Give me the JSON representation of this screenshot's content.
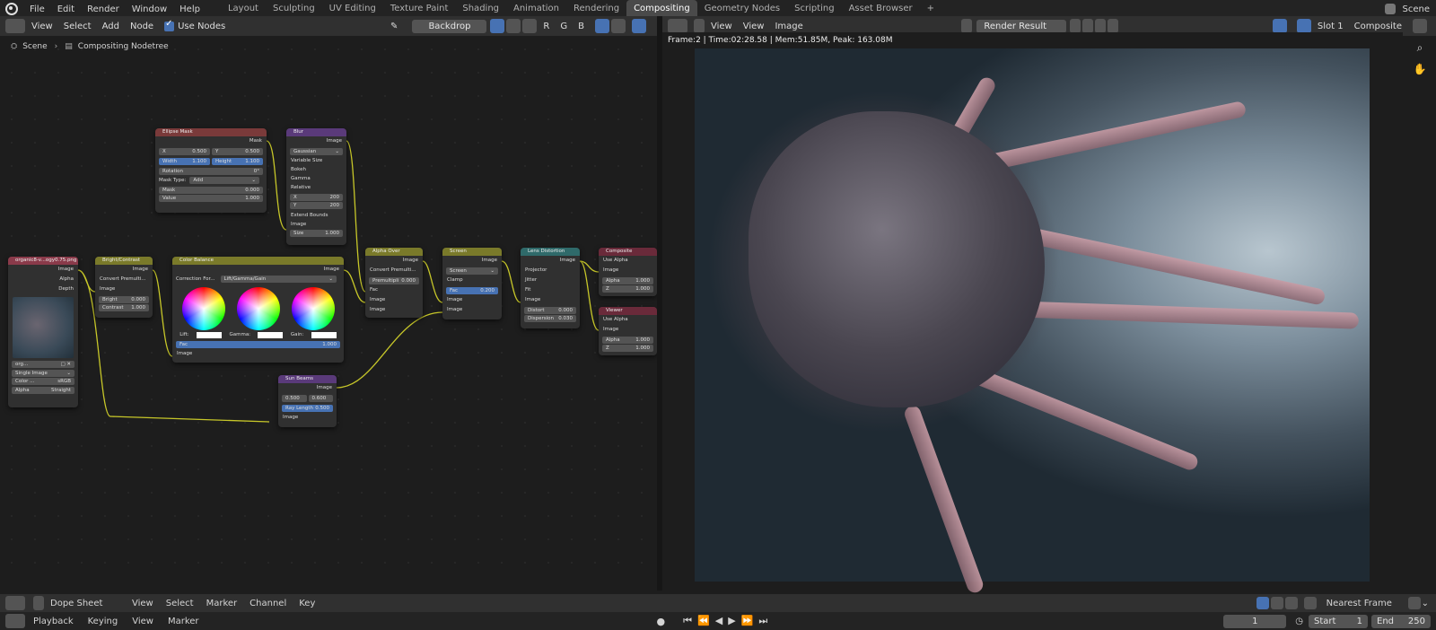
{
  "menu": [
    "File",
    "Edit",
    "Render",
    "Window",
    "Help"
  ],
  "workspaces": [
    "Layout",
    "Sculpting",
    "UV Editing",
    "Texture Paint",
    "Shading",
    "Animation",
    "Rendering",
    "Compositing",
    "Geometry Nodes",
    "Scripting",
    "Asset Browser"
  ],
  "active_workspace": "Compositing",
  "scene_name": "Scene",
  "node_header": {
    "menus": [
      "View",
      "Select",
      "Add",
      "Node"
    ],
    "use_nodes": "Use Nodes",
    "backdrop": "Backdrop",
    "channels": [
      "R",
      "G",
      "B"
    ]
  },
  "breadcrumb": [
    "Scene",
    "Compositing Nodetree"
  ],
  "image_header": {
    "menus": [
      "View",
      "View",
      "Image"
    ],
    "image_name": "Render Result",
    "slot": "Slot 1",
    "layer": "Composite"
  },
  "render_info": "Frame:2 | Time:02:28.58 | Mem:51.85M, Peak: 163.08M",
  "nodes": {
    "ellipse": {
      "title": "Ellipse Mask",
      "out": "Mask",
      "x": "X",
      "x_val": "0.500",
      "y": "Y",
      "y_val": "0.500",
      "width": "Width",
      "width_val": "1.100",
      "height": "Height",
      "height_val": "1.100",
      "rotation": "Rotation",
      "rotation_val": "0°",
      "mask_type": "Mask Type:",
      "mask_type_val": "Add",
      "mask": "Mask",
      "mask_val": "0.000",
      "value": "Value",
      "value_val": "1.000"
    },
    "blur": {
      "title": "Blur",
      "out": "Image",
      "filter": "Gaussian",
      "opts": [
        "Variable Size",
        "Bokeh",
        "Gamma",
        "Relative"
      ],
      "x": "X",
      "x_val": "200",
      "y": "Y",
      "y_val": "200",
      "extend": "Extend Bounds",
      "image": "Image",
      "size": "Size",
      "size_val": "1.000"
    },
    "input": {
      "title": "organic8-v...ogy0.75.png",
      "outs": [
        "Image",
        "Alpha",
        "Depth"
      ],
      "file": "org...",
      "source": "Single Image",
      "color": "Color ...",
      "color_val": "sRGB",
      "alpha": "Alpha",
      "alpha_val": "Straight"
    },
    "bright": {
      "title": "Bright/Contrast",
      "out": "Image",
      "convert": "Convert Premulti...",
      "image": "Image",
      "bright": "Bright",
      "bright_val": "0.000",
      "contrast": "Contrast",
      "contrast_val": "1.000"
    },
    "colorbal": {
      "title": "Color Balance",
      "out": "Image",
      "correction": "Correction For...",
      "correction_val": "Lift/Gamma/Gain",
      "lift": "Lift:",
      "gamma": "Gamma:",
      "gain": "Gain:",
      "fac": "Fac",
      "fac_val": "1.000",
      "image": "Image"
    },
    "alphaover": {
      "title": "Alpha Over",
      "out": "Image",
      "convert": "Convert Premulti...",
      "premul": "Premultipli",
      "premul_val": "0.000",
      "fac": "Fac",
      "image1": "Image",
      "image2": "Image"
    },
    "screen": {
      "title": "Screen",
      "out": "Image",
      "mode": "Screen",
      "clamp": "Clamp",
      "fac": "Fac",
      "fac_val": "0.200",
      "image1": "Image",
      "image2": "Image"
    },
    "lens": {
      "title": "Lens Distortion",
      "out": "Image",
      "projector": "Projector",
      "jitter": "Jitter",
      "fit": "Fit",
      "image": "Image",
      "distort": "Distort",
      "distort_val": "0.000",
      "dispersion": "Dispersion",
      "dispersion_val": "0.030"
    },
    "composite": {
      "title": "Composite",
      "use_alpha": "Use Alpha",
      "image": "Image",
      "alpha": "Alpha",
      "alpha_val": "1.000",
      "z": "Z",
      "z_val": "1.000"
    },
    "viewer": {
      "title": "Viewer",
      "use_alpha": "Use Alpha",
      "image": "Image",
      "alpha": "Alpha",
      "alpha_val": "1.000",
      "z": "Z",
      "z_val": "1.000"
    },
    "sunbeams": {
      "title": "Sun Beams",
      "out": "Image",
      "src_x": "0.500",
      "src_y": "0.600",
      "ray": "Ray Length",
      "ray_val": "0.500",
      "image": "Image"
    }
  },
  "dope": {
    "editor": "Dope Sheet",
    "menus": [
      "View",
      "Select",
      "Marker",
      "Channel",
      "Key"
    ],
    "snap": "Nearest Frame"
  },
  "timeline": {
    "menus": [
      "Playback",
      "Keying",
      "View",
      "Marker"
    ],
    "current": "1",
    "start_label": "Start",
    "start": "1",
    "end_label": "End",
    "end": "250"
  },
  "colors": {
    "accent": "#4772b3",
    "socket_color": "#c7c729",
    "active_tab": "#4a4a4a"
  }
}
